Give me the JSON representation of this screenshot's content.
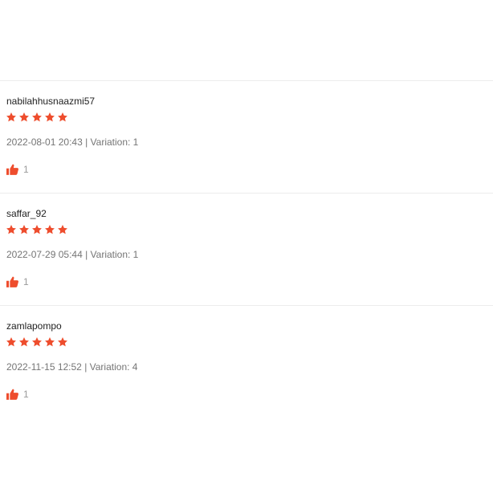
{
  "colors": {
    "star": "#ee4d2d",
    "like_icon": "#ee4d2d",
    "divider": "#ececec",
    "username": "#222222",
    "meta": "#757575"
  },
  "reviews": [
    {
      "username": "nabilahhusnaazmi57",
      "rating": 5,
      "meta": "2022-08-01 20:43 | Variation: 1",
      "likes": "1"
    },
    {
      "username": "saffar_92",
      "rating": 5,
      "meta": "2022-07-29 05:44 | Variation: 1",
      "likes": "1"
    },
    {
      "username": "zamlapompo",
      "rating": 5,
      "meta": "2022-11-15 12:52 | Variation: 4",
      "likes": "1"
    }
  ]
}
